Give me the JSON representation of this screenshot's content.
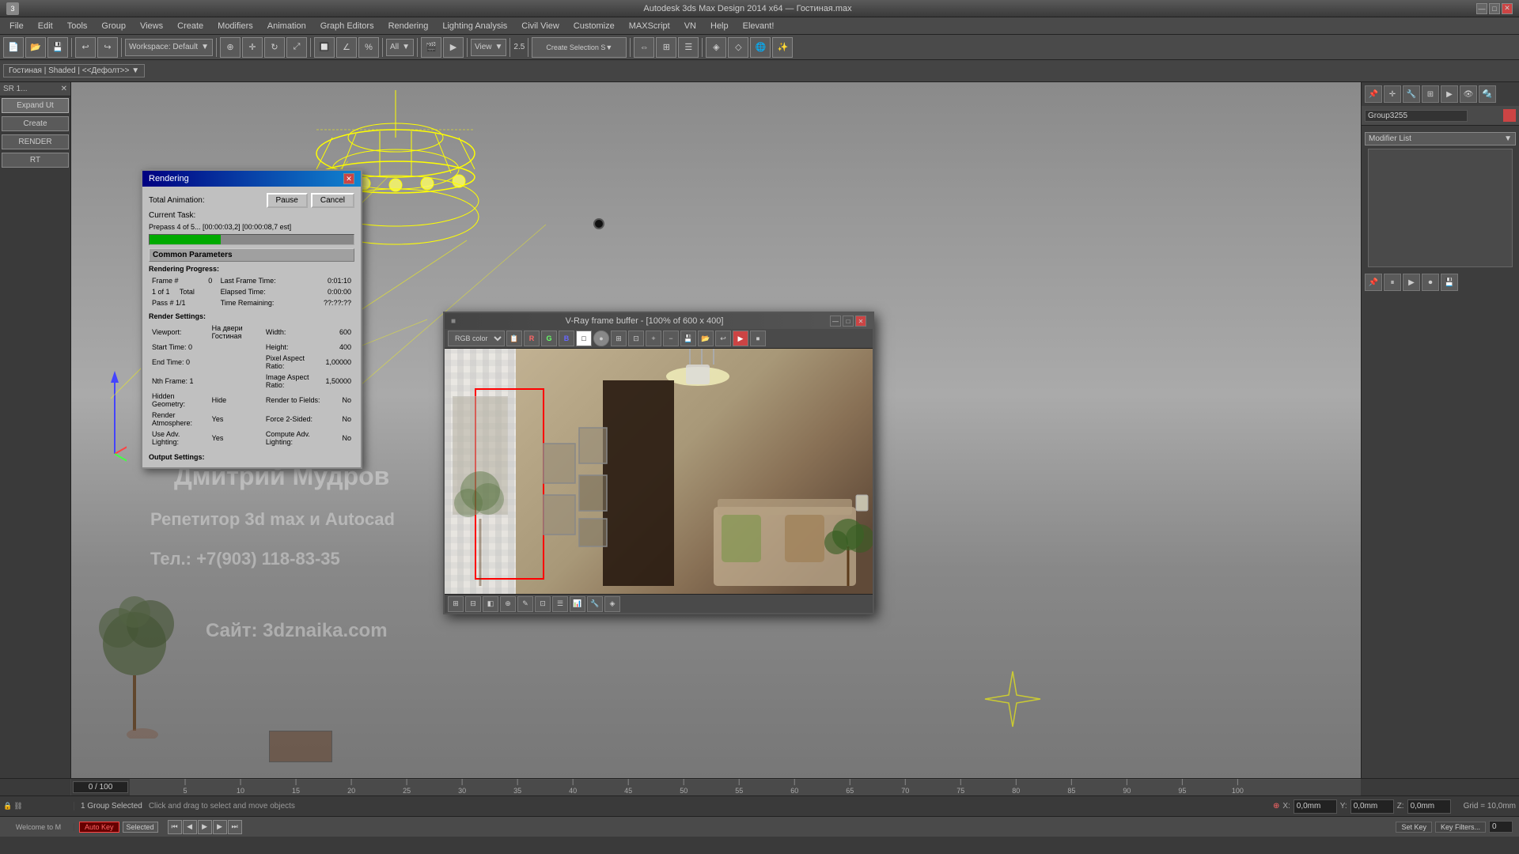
{
  "app": {
    "title": "Autodesk 3ds Max Design 2014 x64 — Гостиная.max",
    "icon": "3ds"
  },
  "title_bar": {
    "min_label": "—",
    "max_label": "□",
    "close_label": "✕"
  },
  "menu_bar": {
    "items": [
      "File",
      "Edit",
      "Tools",
      "Group",
      "Views",
      "Create",
      "Modifiers",
      "Animation",
      "Graph Editors",
      "Rendering",
      "Lighting Analysis",
      "Civil View",
      "Customize",
      "MAXScript",
      "VN",
      "Help",
      "Elevant!"
    ]
  },
  "toolbar": {
    "workspace_label": "Workspace: Default",
    "view_label": "View",
    "zoom_label": "2.5",
    "selection_label": "Create Selection S▼"
  },
  "toolbar2": {
    "breadcrumb": "Гостиная | Shaded | <<Дефолт>>",
    "items": [
      "SR 1..."
    ]
  },
  "left_panel": {
    "header": "SR 1...",
    "buttons": [
      "Expand Ut",
      "Create",
      "RENDER",
      "RT"
    ]
  },
  "rendering_dialog": {
    "title": "Rendering",
    "total_animation_label": "Total Animation:",
    "pause_btn": "Pause",
    "cancel_btn": "Cancel",
    "current_task_label": "Current Task:",
    "current_task_value": "Prepass 4 of 5... [00:00:03,2] [00:00:08,7 est]",
    "progress_percent": 35,
    "section": "Common Parameters",
    "rendering_progress": "Rendering Progress:",
    "frame_label": "Frame #",
    "frame_value": "0",
    "of_1_label": "1",
    "total_label": "Total",
    "pass_label": "Pass # 1/1",
    "last_frame_time": "0:01:10",
    "elapsed_time": "0:00:00",
    "time_remaining": "??:??:??",
    "render_settings": "Render Settings:",
    "viewport": "На двери Гостиная",
    "width": "600",
    "height": "400",
    "start_time": "0",
    "end_time": "0",
    "pixel_aspect_ratio": "1,00000",
    "nth_frame": "1",
    "image_aspect_ratio": "1,50000",
    "render_to_fields": "No",
    "hidden_geometry": "Hide",
    "render_atmosphere": "Yes",
    "force_2sided": "No",
    "use_adv_lighting": "Yes",
    "compute_adv_lighting": "No",
    "output_settings": "Output Settings:"
  },
  "vray_window": {
    "title": "V-Ray frame buffer - [100% of 600 x 400]",
    "color_mode": "RGB color",
    "channels": [
      "R",
      "G",
      "B"
    ],
    "min_label": "—",
    "max_label": "□",
    "close_label": "✕"
  },
  "right_panel": {
    "title": "Group3255",
    "modifier_list_label": "Modifier List",
    "icons": [
      "🔧",
      "⚙",
      "📋",
      "💡",
      "🎨",
      "📷"
    ]
  },
  "viewport": {
    "label": "Гостиная | Shaded | <<Дефолт>>",
    "nav_cube_label": "cube"
  },
  "timeline": {
    "current_frame": "0 / 100",
    "ticks": [
      0,
      5,
      10,
      15,
      20,
      25,
      30,
      35,
      40,
      45,
      50,
      55,
      60,
      65,
      70,
      75,
      80,
      85,
      90,
      95,
      100
    ]
  },
  "status_bar": {
    "group_selected": "1 Group Selected",
    "hint": "Click and drag to select and move objects",
    "x_label": "X:",
    "x_value": "0,0mm",
    "y_label": "Y:",
    "y_value": "0,0mm",
    "z_label": "Z:",
    "z_value": "0,0mm",
    "grid_label": "Grid = 10,0mm",
    "auto_key_label": "Auto Key",
    "selected_label": "Selected",
    "set_key_label": "Set Key",
    "key_filters_label": "Key Filters...",
    "anim_0_label": "0"
  },
  "watermark": {
    "line1": "Дмитрий Мудров",
    "line2": "Репетитор 3d max и Autocad",
    "line3": "Тел.: +7(903) 118-83-35",
    "line4": "Сайт: 3dznaika.com"
  }
}
